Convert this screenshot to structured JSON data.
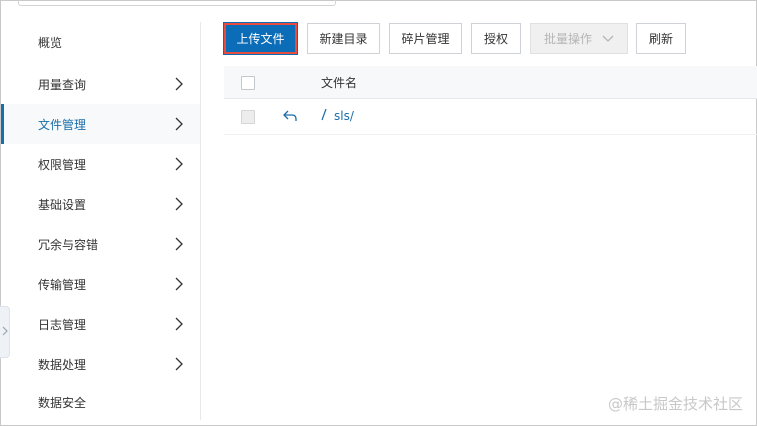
{
  "sidebar": {
    "items": [
      {
        "label": "概览",
        "has_chevron": false,
        "active": false
      },
      {
        "label": "用量查询",
        "has_chevron": true,
        "active": false
      },
      {
        "label": "文件管理",
        "has_chevron": true,
        "active": true
      },
      {
        "label": "权限管理",
        "has_chevron": true,
        "active": false
      },
      {
        "label": "基础设置",
        "has_chevron": true,
        "active": false
      },
      {
        "label": "冗余与容错",
        "has_chevron": true,
        "active": false
      },
      {
        "label": "传输管理",
        "has_chevron": true,
        "active": false
      },
      {
        "label": "日志管理",
        "has_chevron": true,
        "active": false
      },
      {
        "label": "数据处理",
        "has_chevron": true,
        "active": false
      },
      {
        "label": "数据安全",
        "has_chevron": false,
        "active": false
      }
    ]
  },
  "toolbar": {
    "upload_label": "上传文件",
    "new_dir_label": "新建目录",
    "fragment_label": "碎片管理",
    "authorize_label": "授权",
    "batch_label": "批量操作",
    "refresh_label": "刷新"
  },
  "table": {
    "column_name": "文件名",
    "rows": [
      {
        "name": "sls/",
        "icon": "folder-slash-icon"
      }
    ]
  },
  "watermark": "@稀土掘金技术社区",
  "colors": {
    "primary": "#0b6db8",
    "highlight_border": "#e74c3c",
    "active_nav": "#1a6ea8"
  }
}
